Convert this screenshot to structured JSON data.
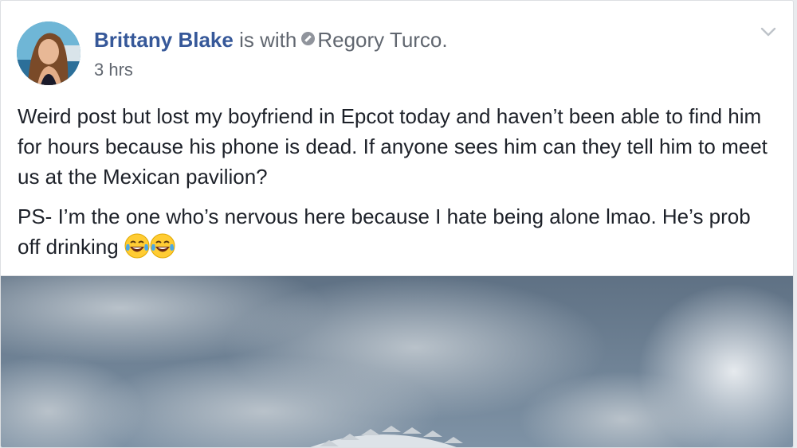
{
  "post": {
    "author": "Brittany Blake",
    "with_text": "is with",
    "tagged_name": "Regory Turco.",
    "timestamp": "3 hrs",
    "paragraph1": "Weird post but lost my boyfriend in Epcot today and haven’t been able to find him for hours because his phone is dead. If anyone sees him can they tell him to meet us at the Mexican pavilion?",
    "paragraph2": "PS- I’m the one who’s nervous here because I hate being alone lmao. He’s prob off drinking",
    "emoji": [
      "face-with-tears-of-joy-icon",
      "face-with-tears-of-joy-icon"
    ]
  },
  "colors": {
    "author_link": "#365899",
    "secondary_text": "#616770",
    "body_text": "#1d2129"
  }
}
